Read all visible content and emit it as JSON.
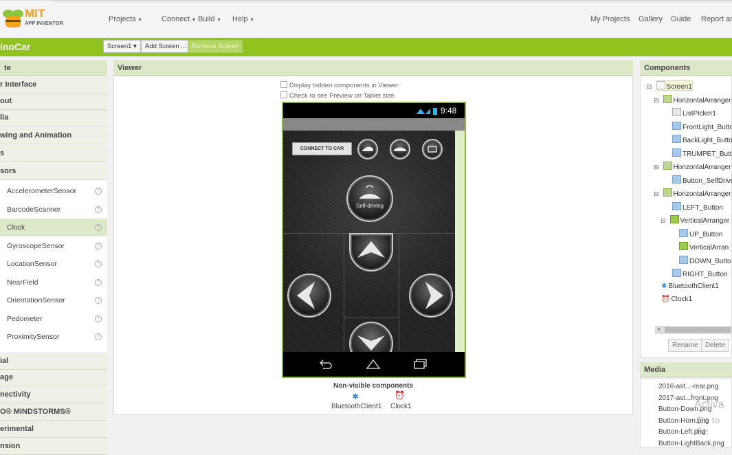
{
  "topbar": {
    "logo_main": "MIT",
    "logo_sub": "APP INVENTOR",
    "menus": [
      "Projects",
      "Connect",
      "Build",
      "Help"
    ],
    "right_links": [
      "My Projects",
      "Gallery",
      "Guide",
      "Report an"
    ]
  },
  "project": {
    "name": "inoCar",
    "screen_select": "Screen1",
    "add_screen": "Add Screen ...",
    "remove_screen": "Remove Screen"
  },
  "palette": {
    "header": "te",
    "categories_top": [
      "r Interface",
      "out",
      "lia",
      "wing and Animation",
      "s",
      "sors"
    ],
    "sensor_items": [
      "AccelerometerSensor",
      "BarcodeScanner",
      "Clock",
      "GyroscopeSensor",
      "LocationSensor",
      "NearField",
      "OrientationSensor",
      "Pedometer",
      "ProximitySensor"
    ],
    "selected_item": "Clock",
    "categories_bottom": [
      "ial",
      "age",
      "nectivity",
      "O® MINDSTORMS®",
      "erimental",
      "nsion"
    ]
  },
  "viewer": {
    "header": "Viewer",
    "checkbox_hidden": "Display hidden components in Viewer",
    "checkbox_tablet": "Check to see Preview on Tablet size.",
    "status_time": "9:48",
    "connect_button": "CONNECT TO CAR",
    "self_driving": "Self-driving",
    "nonvisible_title": "Non-visible components",
    "nonvisible_items": [
      "BluetoothClient1",
      "Clock1"
    ]
  },
  "components": {
    "header": "Components",
    "tree": [
      {
        "label": "Screen1",
        "icon": "screen-icon",
        "toggle": "⊟"
      },
      {
        "label": "HorizontalArranger",
        "icon": "horizontal-arrangement-icon",
        "toggle": "⊟"
      },
      {
        "label": "ListPicker1",
        "icon": "listpicker-icon",
        "toggle": ""
      },
      {
        "label": "FrontLight_Butto",
        "icon": "button-icon",
        "toggle": ""
      },
      {
        "label": "BackLight_Butto",
        "icon": "button-icon",
        "toggle": ""
      },
      {
        "label": "TRUMPET_Butto",
        "icon": "button-icon",
        "toggle": ""
      },
      {
        "label": "HorizontalArranger",
        "icon": "horizontal-arrangement-icon",
        "toggle": "⊟"
      },
      {
        "label": "Button_SelfDrive",
        "icon": "button-icon",
        "toggle": ""
      },
      {
        "label": "HorizontalArranger",
        "icon": "horizontal-arrangement-icon",
        "toggle": "⊟"
      },
      {
        "label": "LEFT_Button",
        "icon": "button-icon",
        "toggle": ""
      },
      {
        "label": "VerticalArranger",
        "icon": "vertical-arrangement-icon",
        "toggle": "⊟"
      },
      {
        "label": "UP_Button",
        "icon": "button-icon",
        "toggle": ""
      },
      {
        "label": "VerticalArran",
        "icon": "vertical-arrangement-icon",
        "toggle": ""
      },
      {
        "label": "DOWN_Butto",
        "icon": "button-icon",
        "toggle": ""
      },
      {
        "label": "RIGHT_Button",
        "icon": "button-icon",
        "toggle": ""
      },
      {
        "label": "BluetoothClient1",
        "icon": "bluetooth-icon",
        "toggle": ""
      },
      {
        "label": "Clock1",
        "icon": "clock-icon",
        "toggle": ""
      }
    ],
    "rename": "Rename",
    "delete": "Delete"
  },
  "media": {
    "header": "Media",
    "files": [
      "2016-ast...-rear.png",
      "2017-ast...front.png",
      "Button-Down.png",
      "Button-Horn.png",
      "Button-Left.png",
      "Button-LightBack.png"
    ]
  },
  "watermark": {
    "line1": "Activa",
    "line2": "Go to Se"
  },
  "colors": {
    "accent_green": "#90c320",
    "header_green": "#dde8c9",
    "phone_border": "#8ab83a"
  }
}
